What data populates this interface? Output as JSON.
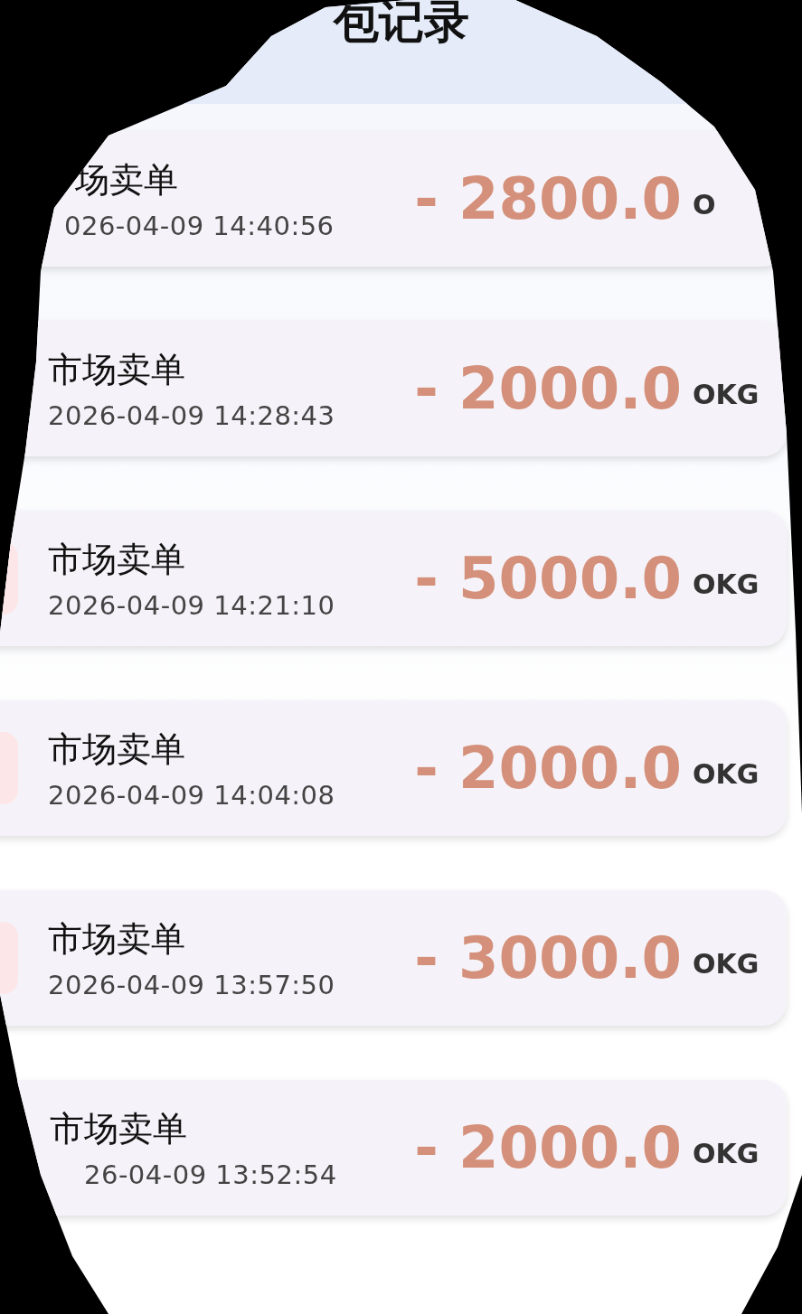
{
  "header": {
    "title": "包记录"
  },
  "records": [
    {
      "name": "场卖单",
      "time": "026-04-09 14:40:56",
      "amount": "- 2800.0",
      "unit": "O"
    },
    {
      "name": "市场卖单",
      "time": "2026-04-09 14:28:43",
      "amount": "- 2000.0",
      "unit": "OKG"
    },
    {
      "name": "市场卖单",
      "time": "2026-04-09 14:21:10",
      "icon": true,
      "amount": "- 5000.0",
      "unit": "OKG"
    },
    {
      "name": "市场卖单",
      "time": "2026-04-09 14:04:08",
      "icon": true,
      "amount": "- 2000.0",
      "unit": "OKG"
    },
    {
      "name": "市场卖单",
      "time": "2026-04-09 13:57:50",
      "icon": true,
      "amount": "- 3000.0",
      "unit": "OKG"
    },
    {
      "name": "市场卖单",
      "time": "26-04-09 13:52:54",
      "amount": "- 2000.0",
      "unit": "OKG"
    }
  ]
}
